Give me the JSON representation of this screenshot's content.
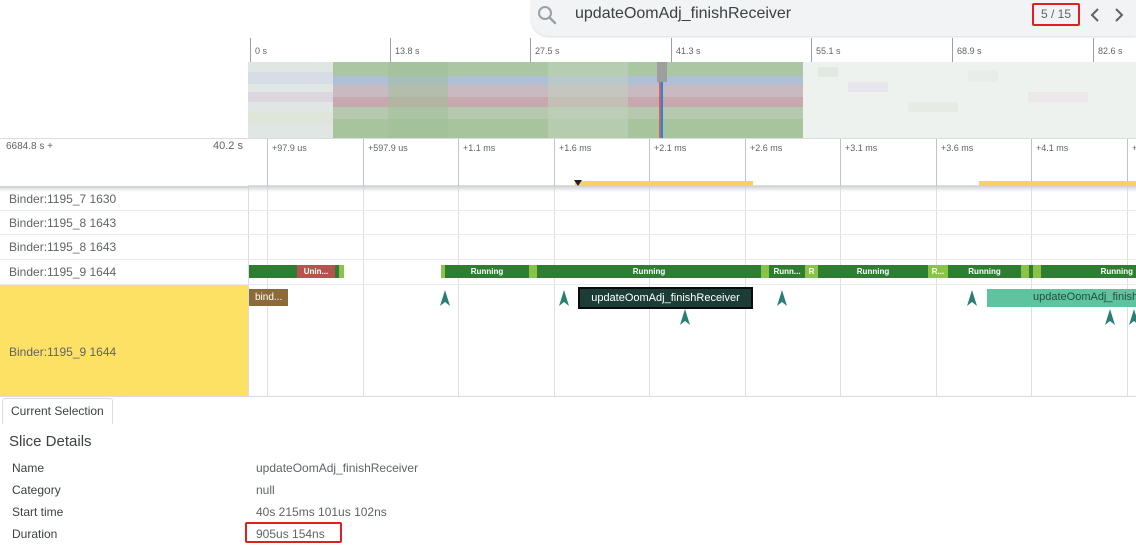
{
  "search": {
    "query": "updateOomAdj_finishReceiver",
    "count": "5 / 15",
    "icon": "search-icon",
    "prev_icon": "chevron-left-icon",
    "next_icon": "chevron-right-icon"
  },
  "overview": {
    "ticks": [
      "0 s",
      "13.8 s",
      "27.5 s",
      "41.3 s",
      "55.1 s",
      "68.9 s",
      "82.6 s"
    ]
  },
  "ruler": {
    "base": "6684.8 s +",
    "offset": "40.2 s",
    "ticks": [
      "+97.9 us",
      "+597.9 us",
      "+1.1 ms",
      "+1.6 ms",
      "+2.1 ms",
      "+2.6 ms",
      "+3.1 ms",
      "+3.6 ms",
      "+4.1 ms",
      "+"
    ]
  },
  "tracks": [
    {
      "label": "Binder:1195_7 1630"
    },
    {
      "label": "Binder:1195_8 1643"
    },
    {
      "label": "Binder:1195_8 1643"
    },
    {
      "label": "Binder:1195_9 1644"
    },
    {
      "label": "Binder:1195_9 1644"
    }
  ],
  "states": [
    {
      "label": "Unin..."
    },
    {
      "label": "Running"
    },
    {
      "label": "Running"
    },
    {
      "label": "Runn..."
    },
    {
      "label": "R"
    },
    {
      "label": "Running"
    },
    {
      "label": "R..."
    },
    {
      "label": "Running"
    },
    {
      "label": "Running"
    }
  ],
  "slices": {
    "binder": "bind...",
    "selected": "updateOomAdj_finishReceiver",
    "next": "updateOomAdj_finishReceiver"
  },
  "details": {
    "tab": "Current Selection",
    "title": "Slice Details",
    "rows": [
      {
        "key": "Name",
        "value": "updateOomAdj_finishReceiver"
      },
      {
        "key": "Category",
        "value": "null"
      },
      {
        "key": "Start time",
        "value": "40s 215ms 101us 102ns"
      },
      {
        "key": "Duration",
        "value": "905us 154ns"
      }
    ]
  },
  "colors": {
    "running": "#2e7d32",
    "runnable": "#8bc34a",
    "uninterruptible": "#b5534e",
    "selected_slice": "#1b3d35",
    "flow_slice": "#5ec4a0",
    "binder_slice": "#8b6b3a",
    "highlight_track": "#fde165",
    "annotation_box": "#e02020"
  }
}
